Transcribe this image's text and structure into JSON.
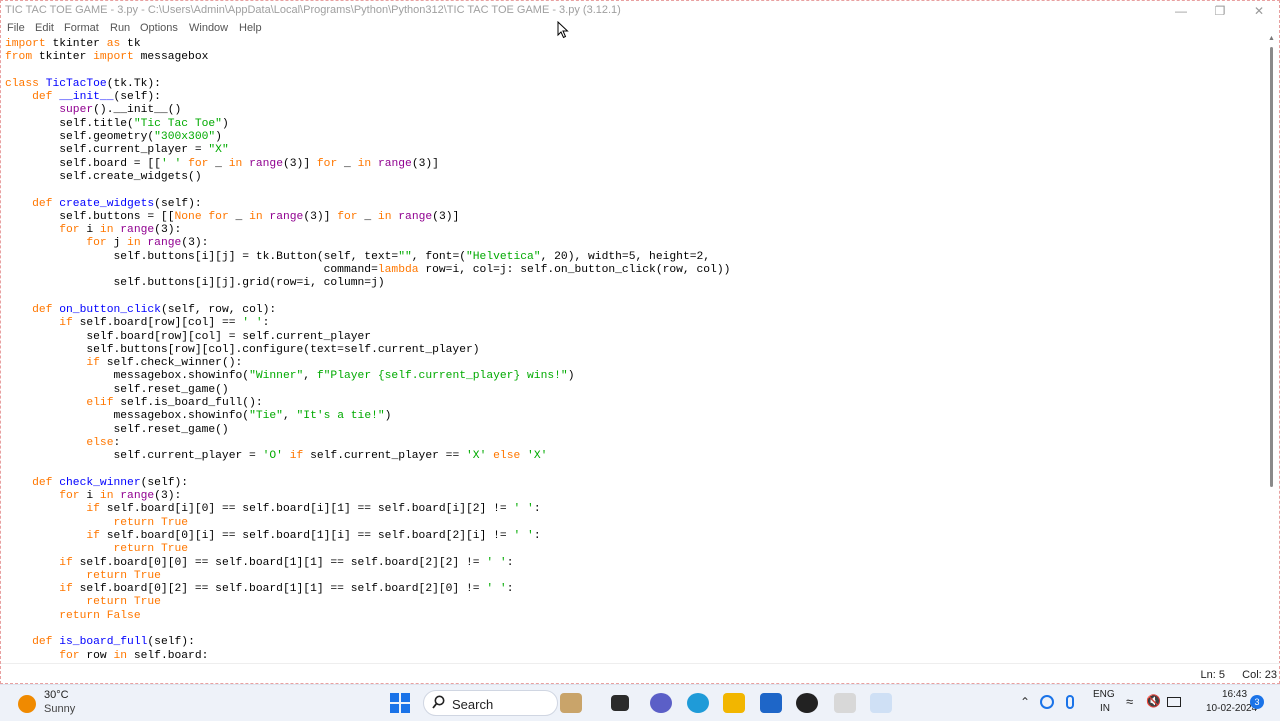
{
  "window": {
    "title": "TIC TAC TOE GAME - 3.py - C:\\Users\\Admin\\AppData\\Local\\Programs\\Python\\Python312\\TIC TAC TOE GAME - 3.py (3.12.1)",
    "minimize_icon": "minimize-icon",
    "restore_icon": "restore-icon",
    "close_icon": "close-icon"
  },
  "menu": [
    "File",
    "Edit",
    "Format",
    "Run",
    "Options",
    "Window",
    "Help"
  ],
  "code_lines": [
    "import tkinter as tk",
    "from tkinter import messagebox",
    "",
    "class TicTacToe(tk.Tk):",
    "    def __init__(self):",
    "        super().__init__()",
    "        self.title(\"Tic Tac Toe\")",
    "        self.geometry(\"300x300\")",
    "        self.current_player = \"X\"",
    "        self.board = [[' ' for _ in range(3)] for _ in range(3)]",
    "        self.create_widgets()",
    "",
    "    def create_widgets(self):",
    "        self.buttons = [[None for _ in range(3)] for _ in range(3)]",
    "        for i in range(3):",
    "            for j in range(3):",
    "                self.buttons[i][j] = tk.Button(self, text=\"\", font=(\"Helvetica\", 20), width=5, height=2,",
    "                                               command=lambda row=i, col=j: self.on_button_click(row, col))",
    "                self.buttons[i][j].grid(row=i, column=j)",
    "",
    "    def on_button_click(self, row, col):",
    "        if self.board[row][col] == ' ':",
    "            self.board[row][col] = self.current_player",
    "            self.buttons[row][col].configure(text=self.current_player)",
    "            if self.check_winner():",
    "                messagebox.showinfo(\"Winner\", f\"Player {self.current_player} wins!\")",
    "                self.reset_game()",
    "            elif self.is_board_full():",
    "                messagebox.showinfo(\"Tie\", \"It's a tie!\")",
    "                self.reset_game()",
    "            else:",
    "                self.current_player = 'O' if self.current_player == 'X' else 'X'",
    "",
    "    def check_winner(self):",
    "        for i in range(3):",
    "            if self.board[i][0] == self.board[i][1] == self.board[i][2] != ' ':",
    "                return True",
    "            if self.board[0][i] == self.board[1][i] == self.board[2][i] != ' ':",
    "                return True",
    "        if self.board[0][0] == self.board[1][1] == self.board[2][2] != ' ':",
    "            return True",
    "        if self.board[0][2] == self.board[1][1] == self.board[2][0] != ' ':",
    "            return True",
    "        return False",
    "",
    "    def is_board_full(self):",
    "        for row in self.board:"
  ],
  "status": {
    "line": "Ln: 5",
    "col": "Col: 23"
  },
  "taskbar": {
    "weather_temp": "30°C",
    "weather_condition": "Sunny",
    "search_label": "Search",
    "lang_top": "ENG",
    "lang_bottom": "IN",
    "time": "16:43",
    "date": "10-02-2024",
    "notification_count": "3"
  },
  "colors": {
    "keyword": "#ff7700",
    "string": "#00aa00",
    "builtin": "#900090",
    "definition": "#0000ff"
  }
}
